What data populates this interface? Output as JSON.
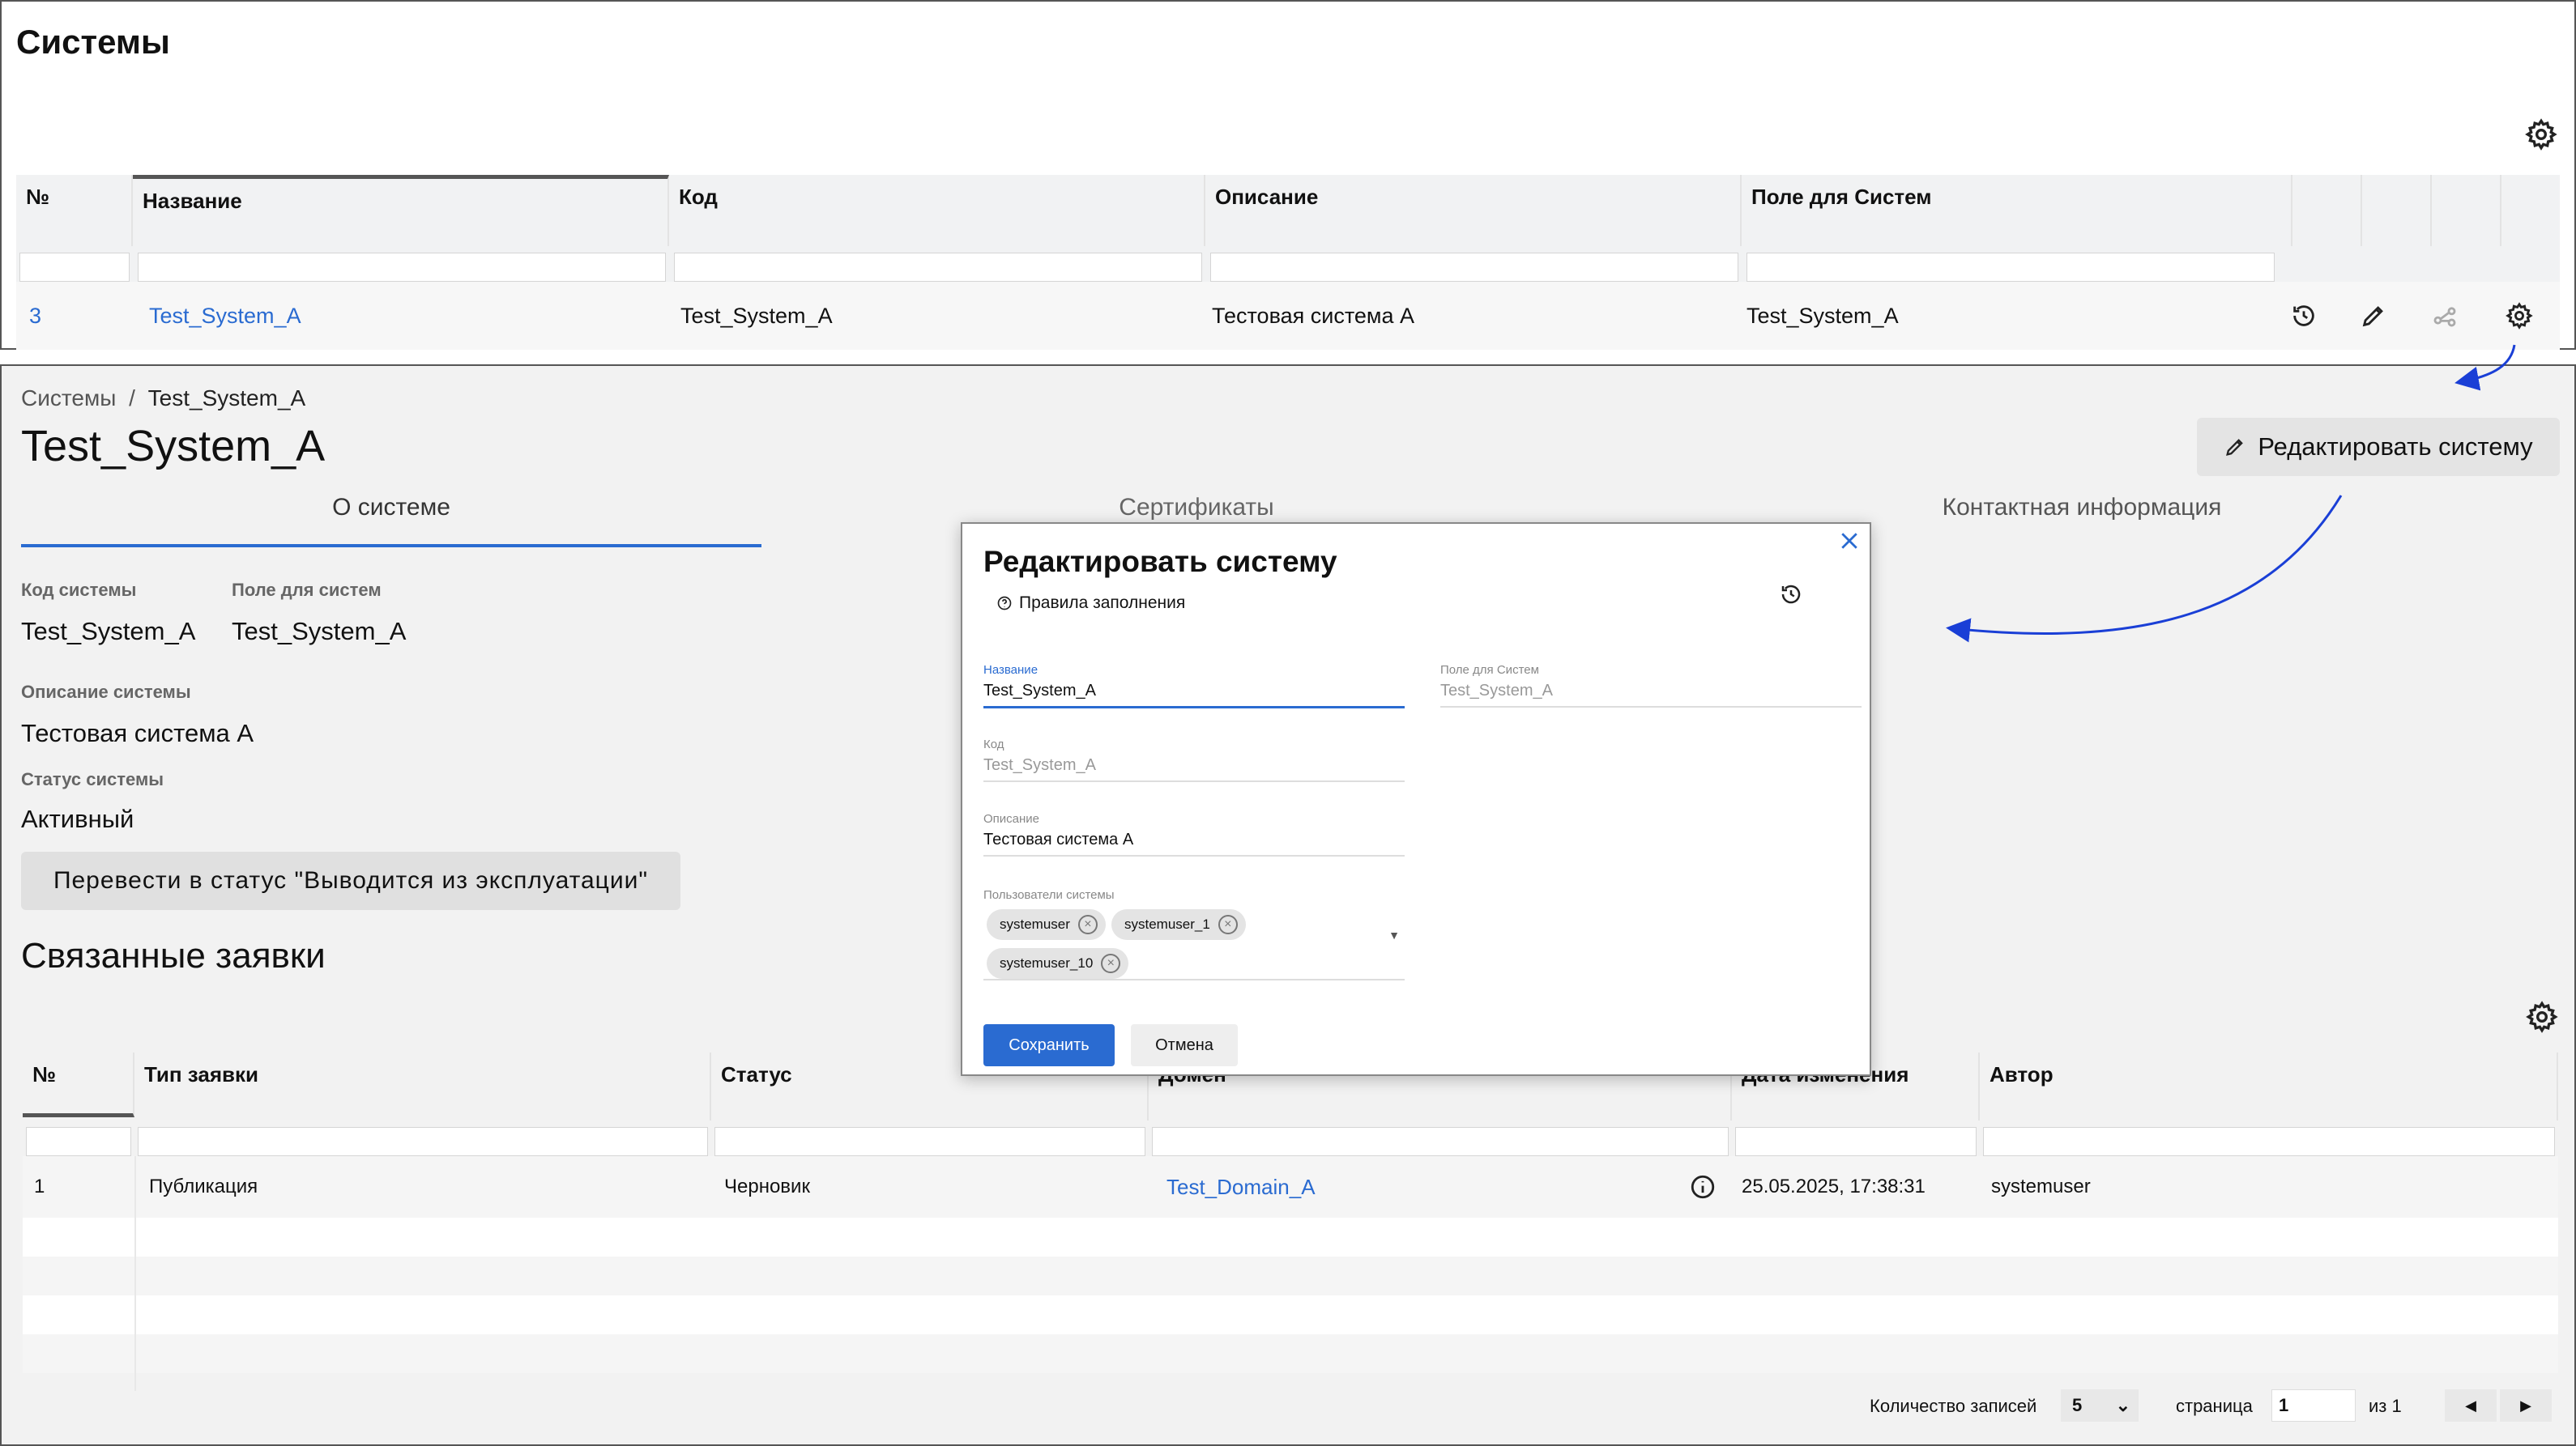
{
  "top": {
    "title": "Системы",
    "table": {
      "headers": [
        "№",
        "Название",
        "Код",
        "Описание",
        "Поле для Систем"
      ],
      "row": {
        "num": "3",
        "name": "Test_System_A",
        "code": "Test_System_A",
        "description": "Тестовая система А",
        "field": "Test_System_A"
      }
    },
    "icons": [
      "history-icon",
      "edit-icon",
      "relations-icon",
      "gear-icon"
    ]
  },
  "detail": {
    "breadcrumb_root": "Системы",
    "breadcrumb_sep": "/",
    "breadcrumb_current": "Test_System_A",
    "title": "Test_System_A",
    "edit_button": "Редактировать систему",
    "tabs": [
      "О системе",
      "Сертификаты",
      "Контактная информация"
    ],
    "fields": {
      "code_label": "Код системы",
      "code_value": "Test_System_A",
      "field_label": "Поле для систем",
      "field_value": "Test_System_A",
      "desc_label": "Описание системы",
      "desc_value": "Тестовая система А",
      "status_label": "Статус системы",
      "status_value": "Активный"
    },
    "status_button": "Перевести в статус \"Выводится из эксплуатации\"",
    "related_title": "Связанные заявки",
    "table": {
      "headers": [
        "№",
        "Тип заявки",
        "Статус",
        "Домен",
        "Дата изменения",
        "Автор"
      ],
      "row": {
        "num": "1",
        "type": "Публикация",
        "status": "Черновик",
        "domain": "Test_Domain_A",
        "date": "25.05.2025, 17:38:31",
        "author": "systemuser"
      }
    },
    "pager": {
      "records_label": "Количество записей",
      "records_value": "5",
      "page_label": "страница",
      "page_value": "1",
      "of_label": "из 1"
    }
  },
  "modal": {
    "title": "Редактировать систему",
    "rules": "Правила заполнения",
    "name_label": "Название",
    "name_value": "Test_System_A",
    "field_label": "Поле для Систем",
    "field_value": "Test_System_A",
    "code_label": "Код",
    "code_value": "Test_System_A",
    "desc_label": "Описание",
    "desc_value": "Тестовая система А",
    "users_label": "Пользователи системы",
    "users": [
      "systemuser",
      "systemuser_1",
      "systemuser_10"
    ],
    "save": "Сохранить",
    "cancel": "Отмена"
  },
  "colors": {
    "accent": "#2a6bd1",
    "arrow": "#1a3fd6"
  }
}
